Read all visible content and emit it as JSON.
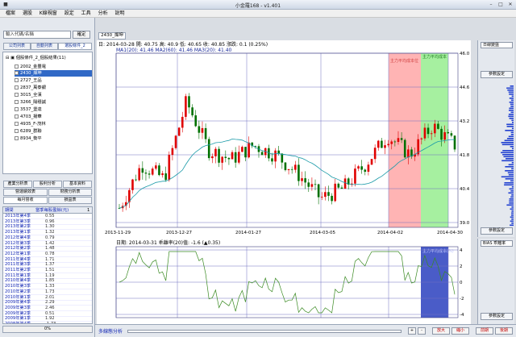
{
  "window": {
    "title": "小金羅1​68 - v1.401"
  },
  "menu": [
    "檔案",
    "選股",
    "K線視窗",
    "設定",
    "工具",
    "分析",
    "說明"
  ],
  "left": {
    "search_placeholder": "輸入代碼/名稱",
    "ok_label": "確定",
    "tabs": [
      "公司列表",
      "自動列表",
      "選股條件_2"
    ],
    "tree_root": "個股條件_2_個股結果(11)",
    "tree_items": [
      "2002_金豐電",
      "2430_燦坤",
      "2727_王品",
      "2837_萬泰銀",
      "3015_全漢",
      "3266_陽穩誠",
      "3537_堡達",
      "4703_揚華",
      "4935_F-茂林",
      "6289_群聯",
      "8934_衡平"
    ],
    "buttons_row1": [
      "產業分析表",
      "股利分析",
      "基本資料"
    ],
    "buttons_row2": [
      "營運績效表",
      "財務分析表"
    ],
    "buttons_row3": [
      "每月營收",
      "損益表"
    ],
    "table_header": [
      "期間",
      "當季每股盈餘(元)",
      "1"
    ],
    "rows": [
      [
        "2013年第4季",
        "0.55"
      ],
      [
        "2013年第3季",
        "0.96"
      ],
      [
        "2013年第2季",
        "1.30"
      ],
      [
        "2013年第1季",
        "1.32"
      ],
      [
        "2012年第4季",
        "0.79"
      ],
      [
        "2012年第3季",
        "1.42"
      ],
      [
        "2012年第2季",
        "1.48"
      ],
      [
        "2012年第1季",
        "0.78"
      ],
      [
        "2011年第4季",
        "1.71"
      ],
      [
        "2011年第3季",
        "1.37"
      ],
      [
        "2011年第2季",
        "1.51"
      ],
      [
        "2011年第1季",
        "1.19"
      ],
      [
        "2010年第4季",
        "1.85"
      ],
      [
        "2010年第3季",
        "1.33"
      ],
      [
        "2010年第2季",
        "1.73"
      ],
      [
        "2010年第1季",
        "2.01"
      ],
      [
        "2009年第4季",
        "2.29"
      ],
      [
        "2009年第3季",
        "2.46"
      ],
      [
        "2009年第2季",
        "0.51"
      ],
      [
        "2009年第1季",
        "1.92"
      ],
      [
        "2008年第4季",
        "-1.73"
      ]
    ],
    "progress": "0%"
  },
  "stock_tab": "2430_燦坤",
  "main_chart": {
    "info_line": "日: 2014-03-28  開: 40.75  高: 40.9  低: 40.65  收: 40.85  漲跌: 0.1 (0.25%)",
    "ma_line": "MA1(20): 41.46  MA2(60): 41.46  MA3(20): 41.40",
    "y_ticks": [
      "46.0",
      "44.6",
      "43.2",
      "41.8",
      "40.4",
      "39.0"
    ],
    "x_ticks": [
      "2013-11-29",
      "2013-12-27",
      "2014-01-27",
      "2014-03-05",
      "2014-04-02",
      "2014-04-30"
    ],
    "annot_red": "主力平均成本位",
    "annot_green": "主力平均成本",
    "colors": {
      "up": "#e00000",
      "down": "#007000",
      "ma": "#1a9aa8",
      "zone_red": "#ffb4b4",
      "zone_green": "#a6f0a0"
    }
  },
  "sub_chart": {
    "info_line": "日期: 2014-03-31   乖離率(20)值: -1.6 (▲0.35)",
    "y_ticks": [
      "4",
      "2",
      "0",
      "-2",
      "-4"
    ],
    "annot": "主力平均成本(%)",
    "colors": {
      "line": "#3a8a22",
      "zone": "#4a5cc8"
    }
  },
  "right": {
    "top_select": "日線變盤",
    "top_btn": "參數設定",
    "bot_select": "BIAS 乖離率",
    "bot_btn": "參數設定"
  },
  "bottom": {
    "label": "多線態分析",
    "buttons": [
      "+",
      "-",
      "放大",
      "縮小",
      "前期",
      "後期"
    ]
  }
}
